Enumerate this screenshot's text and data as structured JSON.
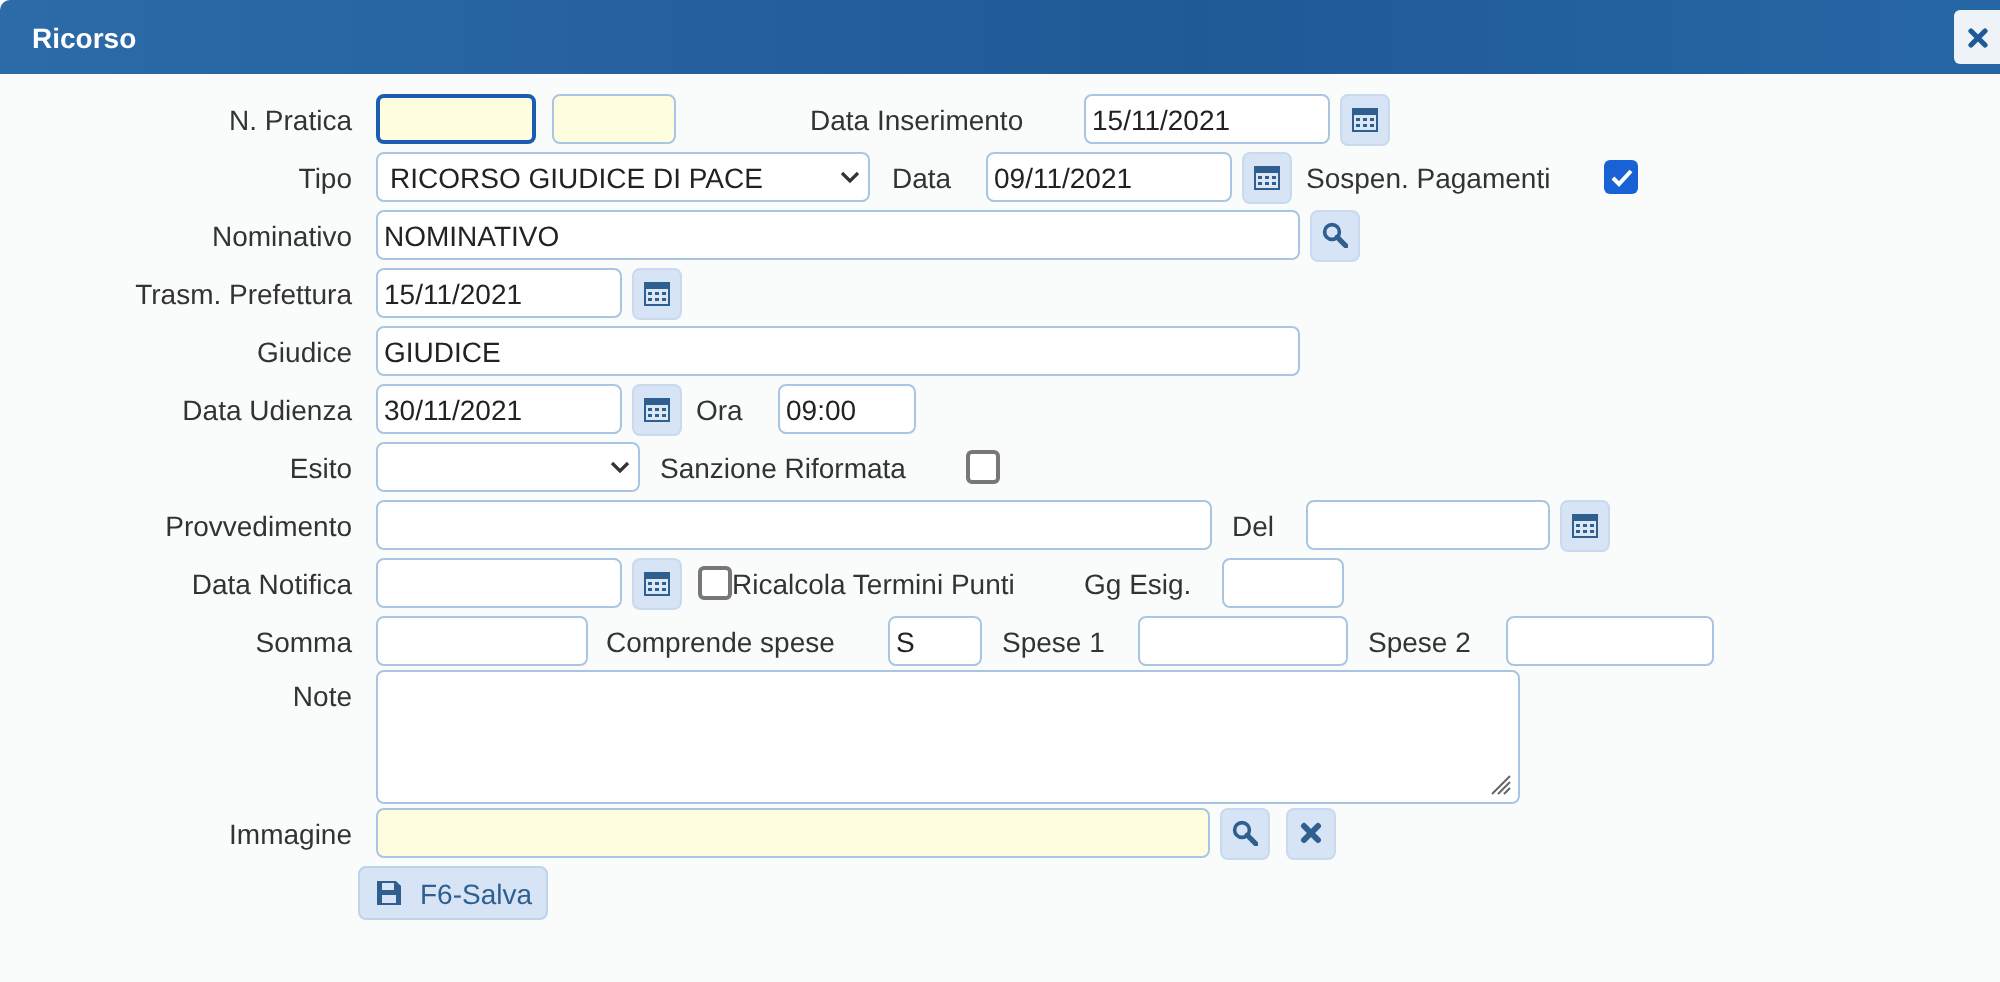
{
  "window": {
    "title": "Ricorso"
  },
  "rows": [
    {
      "label": "N. Pratica",
      "controls": [
        {
          "kind": "input",
          "focused": true,
          "mandatory": true
        },
        {
          "kind": "input",
          "focused": false,
          "mandatory": true
        },
        {
          "kind": "label",
          "text": "Data Inserimento"
        },
        {
          "kind": "date",
          "value": "15/11/2021"
        }
      ]
    },
    {
      "label": "Tipo",
      "controls": [
        {
          "kind": "select",
          "value": "RICORSO GIUDICE DI PACE"
        },
        {
          "kind": "label",
          "text": "Data"
        },
        {
          "kind": "date",
          "value": "09/11/2021"
        },
        {
          "kind": "label",
          "text": "Sospen. Pagamenti"
        },
        {
          "kind": "checkbox",
          "checked": true
        }
      ]
    },
    {
      "label": "Nominativo",
      "controls": [
        {
          "kind": "input",
          "value": "NOMINATIVO",
          "focused": false,
          "mandatory": false
        },
        {
          "kind": "search-button"
        }
      ]
    },
    {
      "label": "Trasm. Prefettura",
      "controls": [
        {
          "kind": "date",
          "value": "15/11/2021"
        }
      ]
    },
    {
      "label": "Giudice",
      "controls": [
        {
          "kind": "input",
          "value": "GIUDICE",
          "focused": false,
          "mandatory": false
        }
      ]
    },
    {
      "label": "Data Udienza",
      "controls": [
        {
          "kind": "date",
          "value": "30/11/2021"
        },
        {
          "kind": "label",
          "text": "Ora"
        },
        {
          "kind": "input",
          "value": "09:00",
          "focused": false,
          "mandatory": false
        }
      ]
    },
    {
      "label": "Esito",
      "controls": [
        {
          "kind": "select"
        },
        {
          "kind": "label",
          "text": "Sanzione Riformata"
        },
        {
          "kind": "checkbox",
          "checked": false
        }
      ]
    },
    {
      "label": "Provvedimento",
      "controls": [
        {
          "kind": "input",
          "focused": false,
          "mandatory": false
        },
        {
          "kind": "label",
          "text": "Del"
        },
        {
          "kind": "date"
        }
      ]
    },
    {
      "label": "Data Notifica",
      "controls": [
        {
          "kind": "date"
        },
        {
          "kind": "checkbox",
          "checked": false
        },
        {
          "kind": "label",
          "text": "Ricalcola Termini Punti"
        },
        {
          "kind": "label",
          "text": "Gg Esig."
        },
        {
          "kind": "input",
          "focused": false,
          "mandatory": false
        }
      ]
    },
    {
      "label": "Somma",
      "controls": [
        {
          "kind": "input",
          "focused": false,
          "mandatory": false
        },
        {
          "kind": "label",
          "text": "Comprende spese"
        },
        {
          "kind": "input",
          "value": "S",
          "focused": false,
          "mandatory": false
        },
        {
          "kind": "label",
          "text": "Spese 1"
        },
        {
          "kind": "input",
          "focused": false,
          "mandatory": false
        },
        {
          "kind": "label",
          "text": "Spese 2"
        },
        {
          "kind": "input",
          "focused": false,
          "mandatory": false
        }
      ]
    },
    {
      "label": "Note",
      "controls": [
        {
          "kind": "textarea"
        }
      ]
    },
    {
      "label": "Immagine",
      "controls": [
        {
          "kind": "input",
          "focused": false,
          "mandatory": true
        },
        {
          "kind": "search-button"
        },
        {
          "kind": "clear-button"
        }
      ]
    }
  ],
  "save_button": {
    "label": "F6-Salva"
  }
}
